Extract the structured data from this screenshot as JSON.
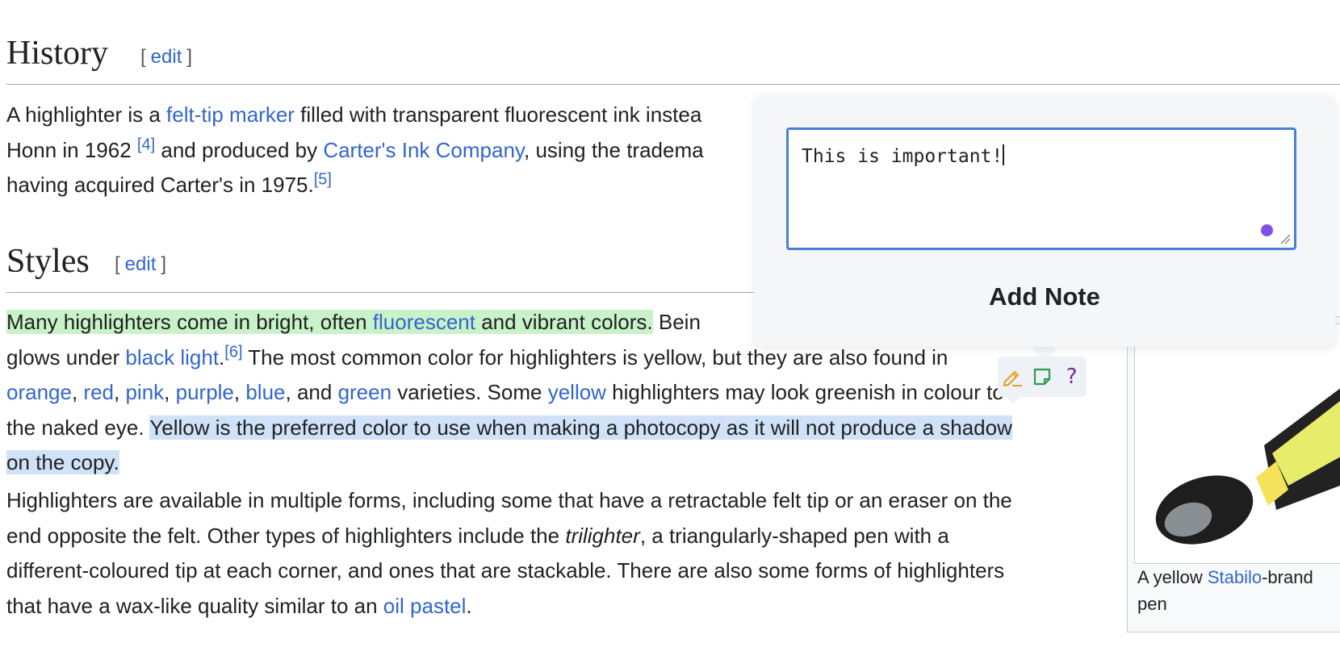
{
  "history": {
    "heading": "History",
    "edit_label": "edit",
    "paragraph": {
      "line1_a": "A highlighter is a ",
      "felt_tip_link": "felt-tip marker",
      "line1_b": " filled with transparent fluorescent ink instea",
      "line2_a": "Honn in 1962 ",
      "ref4": "[4]",
      "line2_b": " and produced by ",
      "carters_link": "Carter's Ink Company",
      "line2_c": ", using the tradema",
      "line3_a": "having acquired Carter's in 1975.",
      "ref5": "[5]"
    }
  },
  "styles": {
    "heading": "Styles",
    "edit_label": "edit",
    "para1": {
      "green_a": "Many highlighters come in bright, often ",
      "fluorescent_link": "fluorescent",
      "green_b": " and vibrant colors.",
      "after_green": " Bein",
      "line2_a": "glows under ",
      "black_light_link": "black light",
      "line2_b": ".",
      "ref6": "[6]",
      "line2_c": " The most common color for highlighters is yellow, but they are also found in",
      "orange": "orange",
      "red": "red",
      "pink": "pink",
      "purple": "purple",
      "blue": "blue",
      "and_text": ", and ",
      "green": "green",
      "line3_b": " varieties. Some ",
      "yellow": "yellow",
      "line3_c": " highlighters may look greenish in c",
      "line3_d": "olour to",
      "line4_a": "the naked eye. ",
      "blue_hl_a": "Yellow is the preferred color to use when making a photocopy as it will not produce a shadow",
      "blue_hl_b": "on the copy."
    },
    "para2": {
      "line1": "Highlighters are available in multiple forms, including some that have a retractable felt tip or an eraser on the",
      "line2_a": "end opposite the felt. Other types of highlighters include the ",
      "trilighter": "trilighter",
      "line2_b": ", a triangularly-shaped pen with a",
      "line3": "different-coloured tip at each corner, and ones that are stackable. There are also some forms of highlighters",
      "line4_a": "that have a wax-like quality similar to an ",
      "oil_pastel_link": "oil pastel",
      "line4_b": "."
    }
  },
  "figure": {
    "caption_a": "A yellow ",
    "stabilo_link": "Stabilo",
    "caption_b": "-brand",
    "caption_c": "pen"
  },
  "popup": {
    "note_value": "This is important!",
    "add_note_label": "Add Note"
  },
  "toolbar": {
    "icons": [
      "highlight-pen-icon",
      "sticky-note-icon",
      "help-icon"
    ],
    "help_glyph": "?"
  },
  "colors": {
    "link": "#3366cc",
    "green_highlight": "#c9f2c9",
    "blue_highlight": "#cfe2f7",
    "popup_bg": "#f4f6f8",
    "focus_border": "#4a7fd6",
    "dot": "#7b52e4"
  }
}
